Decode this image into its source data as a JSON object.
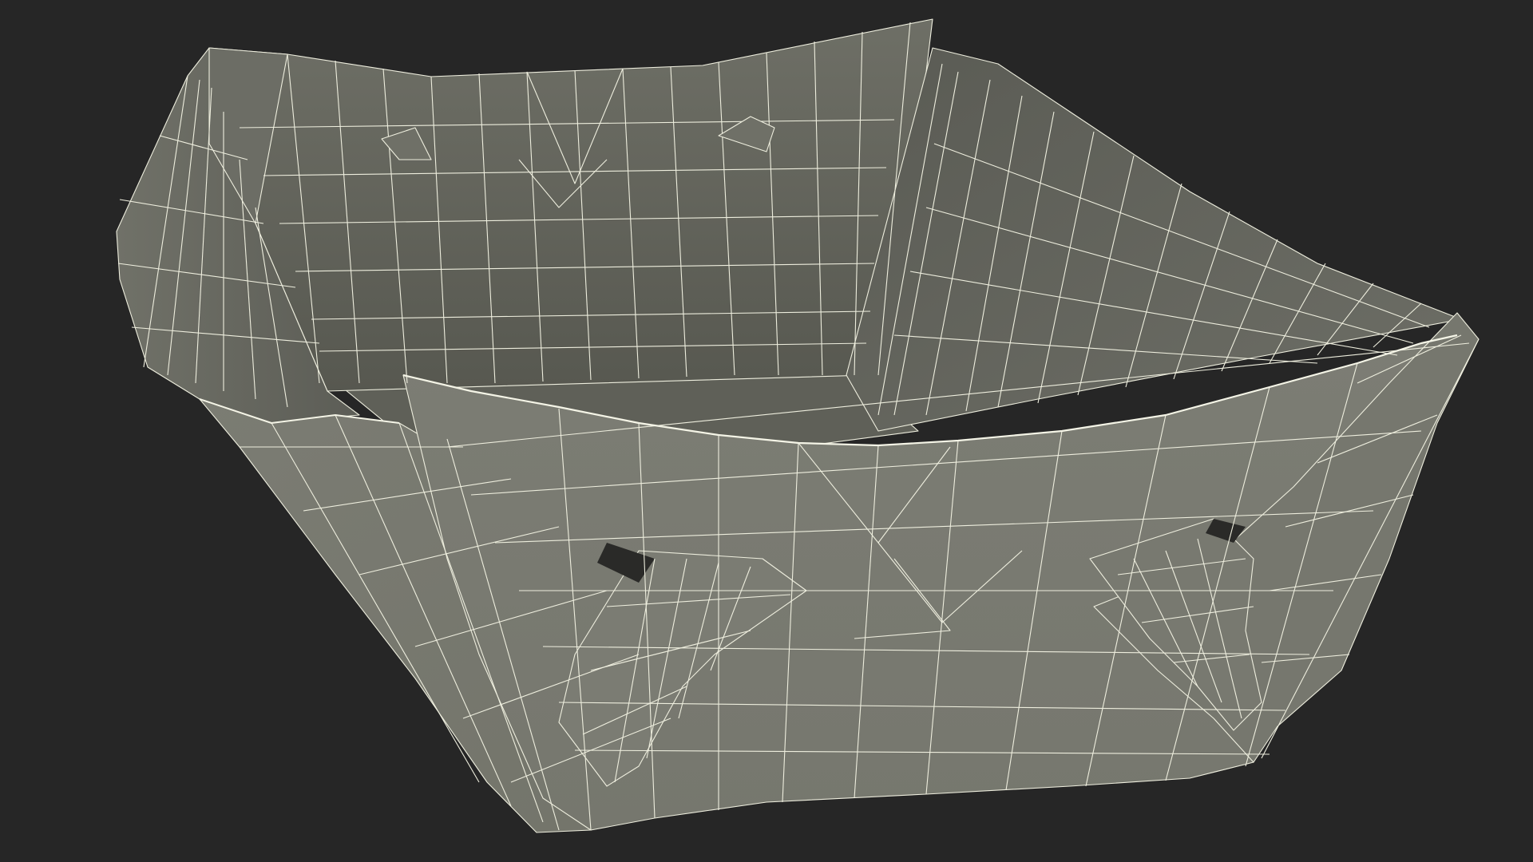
{
  "scene": {
    "background_color": "#262626",
    "subject": "paper-food-tray-wireframe",
    "surface_colors": {
      "outer_light": "#7a7b72",
      "outer_mid": "#72736a",
      "inner_dark": "#5b5c55",
      "inner_mid": "#66675f",
      "floor": "#5f6058",
      "wire": "#eeeede"
    }
  }
}
